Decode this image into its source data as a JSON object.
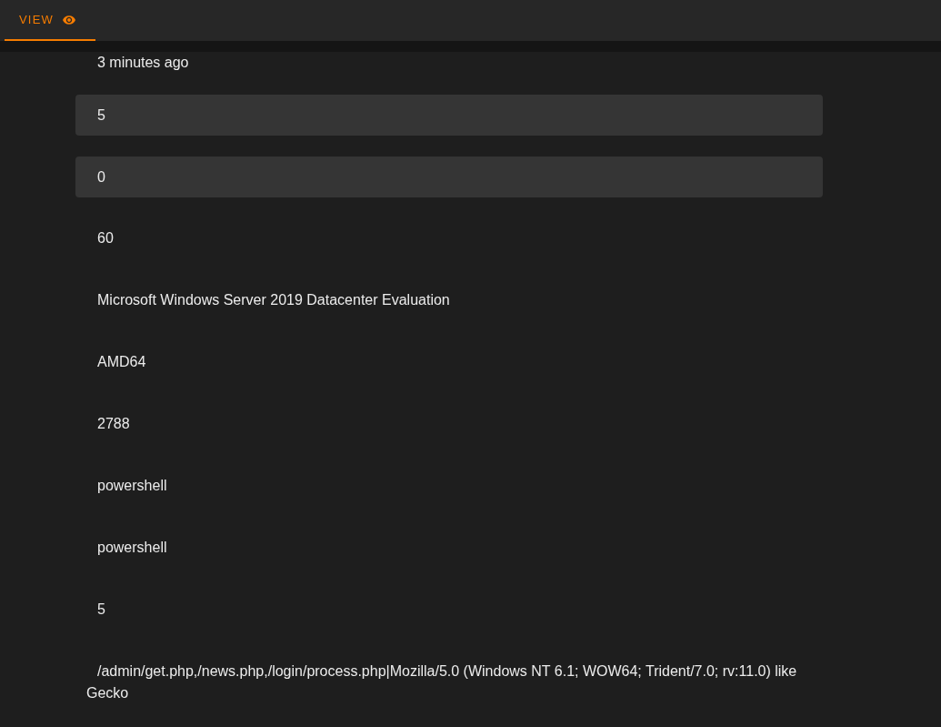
{
  "tabs": [
    {
      "label": "VIEW",
      "selected": true
    }
  ],
  "fields": [
    {
      "kind": "text",
      "value": "3 minutes ago"
    },
    {
      "kind": "input",
      "value": "5"
    },
    {
      "kind": "input",
      "value": "0"
    },
    {
      "kind": "text",
      "value": "60"
    },
    {
      "kind": "text",
      "value": "Microsoft Windows Server 2019 Datacenter Evaluation"
    },
    {
      "kind": "text",
      "value": "AMD64"
    },
    {
      "kind": "text",
      "value": "2788"
    },
    {
      "kind": "text",
      "value": "powershell"
    },
    {
      "kind": "text",
      "value": "powershell"
    },
    {
      "kind": "text",
      "value": "5"
    },
    {
      "kind": "text",
      "value": "/admin/get.php,/news.php,/login/process.php|Mozilla/5.0 (Windows NT 6.1; WOW64; Trident/7.0; rv:11.0) like Gecko"
    }
  ]
}
